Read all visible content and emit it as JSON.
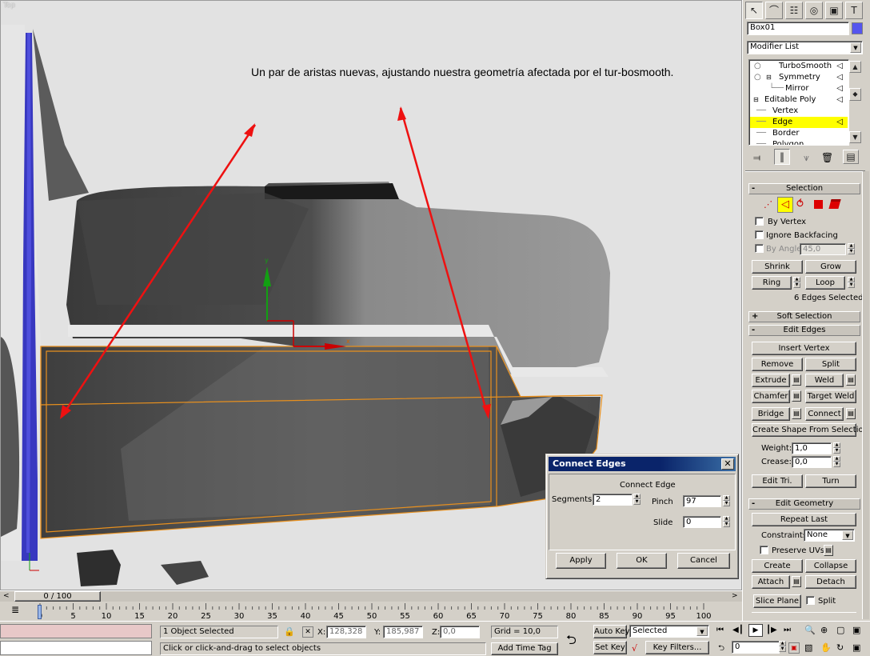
{
  "viewport": {
    "label": "Top",
    "annotation": "Un par de aristas nuevas, ajustando nuestra geometría afectada por el tur-bosmooth.",
    "gizmo_y": "y",
    "gizmo_x": "x"
  },
  "command_panel": {
    "tabs": [
      "create-icon",
      "modify-icon",
      "hierarchy-icon",
      "motion-icon",
      "display-icon",
      "utilities-icon"
    ],
    "object_name": "Box01",
    "object_color": "#5555ee",
    "modifier_list": "Modifier List",
    "stack": [
      {
        "label": "TurboSmooth"
      },
      {
        "label": "Symmetry"
      },
      {
        "label": "Mirror"
      },
      {
        "label": "Editable Poly"
      },
      {
        "label": "Vertex"
      },
      {
        "label": "Edge"
      },
      {
        "label": "Border"
      },
      {
        "label": "Polygon"
      }
    ],
    "selection": {
      "header": "Selection",
      "by_vertex": "By Vertex",
      "ignore_backfacing": "Ignore Backfacing",
      "by_angle": "By Angle:",
      "by_angle_value": "45,0",
      "shrink": "Shrink",
      "grow": "Grow",
      "ring": "Ring",
      "loop": "Loop",
      "status": "6 Edges Selected"
    },
    "soft_selection": {
      "header": "Soft Selection"
    },
    "edit_edges": {
      "header": "Edit Edges",
      "insert_vertex": "Insert Vertex",
      "remove": "Remove",
      "split": "Split",
      "extrude": "Extrude",
      "weld": "Weld",
      "chamfer": "Chamfer",
      "target_weld": "Target Weld",
      "bridge": "Bridge",
      "connect": "Connect",
      "create_shape": "Create Shape From Selection",
      "weight_label": "Weight:",
      "weight_value": "1,0",
      "crease_label": "Crease:",
      "crease_value": "0,0",
      "edit_tri": "Edit Tri.",
      "turn": "Turn"
    },
    "edit_geometry": {
      "header": "Edit Geometry",
      "repeat_last": "Repeat Last",
      "constraints_label": "Constraints:",
      "constraints_value": "None",
      "preserve_uvs": "Preserve UVs",
      "create": "Create",
      "collapse": "Collapse",
      "attach": "Attach",
      "detach": "Detach",
      "slice_plane": "Slice Plane",
      "split": "Split"
    }
  },
  "dialog": {
    "title": "Connect Edges",
    "group_label": "Connect Edge",
    "segments_label": "Segments:",
    "segments_value": "2",
    "pinch_label": "Pinch",
    "pinch_value": "97",
    "slide_label": "Slide",
    "slide_value": "0",
    "apply": "Apply",
    "ok": "OK",
    "cancel": "Cancel"
  },
  "timeline": {
    "frame_display": "0 / 100",
    "ticks": [
      "0",
      "5",
      "10",
      "15",
      "20",
      "25",
      "30",
      "35",
      "40",
      "45",
      "50",
      "55",
      "60",
      "65",
      "70",
      "75",
      "80",
      "85",
      "90",
      "95",
      "100"
    ]
  },
  "status": {
    "selection_info": "1 Object Selected",
    "prompt": "Click or click-and-drag to select objects",
    "x_label": "X:",
    "x_value": "128,328",
    "y_label": "Y:",
    "y_value": "185,987",
    "z_label": "Z:",
    "z_value": "0,0",
    "grid": "Grid = 10,0",
    "add_time_tag": "Add Time Tag",
    "auto_key": "Auto Key",
    "set_key": "Set Key",
    "selected_value": "Selected",
    "key_filters": "Key Filters...",
    "current_frame": "0"
  }
}
